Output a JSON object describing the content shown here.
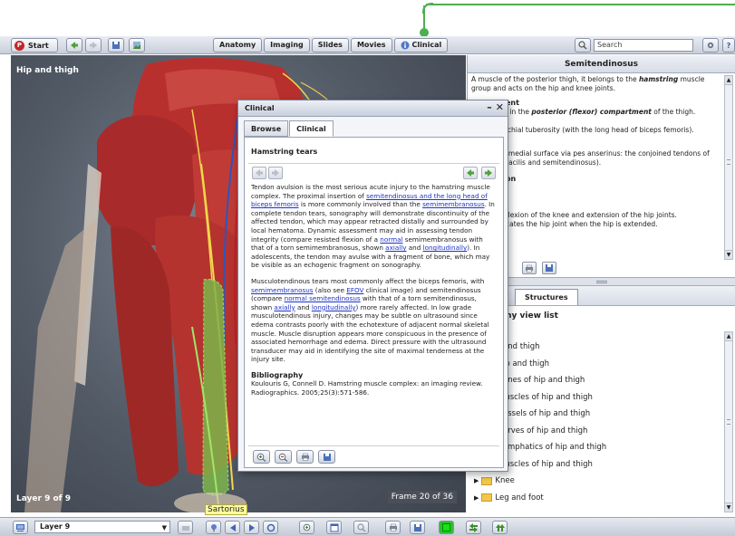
{
  "toolbar": {
    "start_label": "Start",
    "tabs": [
      "Anatomy",
      "Imaging",
      "Slides",
      "Movies",
      "Clinical"
    ],
    "search_placeholder": "Search"
  },
  "viewport": {
    "title": "Hip and thigh",
    "layer_status": "Layer 9 of 9",
    "frame_status": "Frame 20 of 36",
    "tooltip": "Sartorius"
  },
  "info_panel": {
    "title": "Semitendinosus",
    "intro_1": "A muscle of the posterior thigh, it belongs to the ",
    "intro_em": "hamstring",
    "intro_2": " muscle group and acts on the hip and knee joints.",
    "heading_1": "ent",
    "compartment_1": "l in the ",
    "compartment_em": "posterior (flexor) compartment",
    "compartment_2": " of the thigh.",
    "origin": "schial tuberosity (with the long head of biceps femoris).",
    "insertion_1": "(medial surface via pes anserinus: the conjoined tendons of",
    "insertion_2": "racilis and semitendinosus).",
    "heading_2": "on",
    "nerve_frag": ".",
    "action_1": "flexion of the knee and extension of the hip joints.",
    "action_2": "cates the hip joint when the hip is extended."
  },
  "structures": {
    "tab": "Structures",
    "heading": "omy view list",
    "items": [
      "and thigh",
      "ip and thigh",
      "ones of hip and thigh",
      "luscles of hip and thigh",
      "essels of hip and thigh",
      "erves of hip and thigh",
      "ymphatics of hip and thigh",
      "luscles of hip and thigh",
      "Knee",
      "Leg and foot"
    ]
  },
  "dialog": {
    "title": "Clinical",
    "tabs": [
      "Browse",
      "Clinical"
    ],
    "topic": "Hamstring tears",
    "p1": [
      {
        "t": "Tendon avulsion is the most serious acute injury to the hamstring muscle complex. The proximal insertion of "
      },
      {
        "t": "semitendinosus and the long head of biceps femoris",
        "link": true
      },
      {
        "t": " is more commonly involved than the "
      },
      {
        "t": "semimembranosus",
        "link": true
      },
      {
        "t": ". In complete tendon tears, sonography will demonstrate discontinuity of the affected tendon, which may appear retracted distally and surrounded by local hematoma. Dynamic assessment may aid in assessing tendon integrity (compare resisted flexion of a "
      },
      {
        "t": "normal",
        "link": true
      },
      {
        "t": " semimembranosus with that of a torn semimembranosus, shown "
      },
      {
        "t": "axially",
        "link": true
      },
      {
        "t": " and "
      },
      {
        "t": "longitudinally",
        "link": true
      },
      {
        "t": "). In adolescents, the tendon may avulse with a fragment of bone, which may be visible as an echogenic fragment on sonography."
      }
    ],
    "p2": [
      {
        "t": "Musculotendinous tears most commonly affect the biceps femoris, with "
      },
      {
        "t": "semimembranosus",
        "link": true
      },
      {
        "t": " (also see "
      },
      {
        "t": "EFOV",
        "link": true
      },
      {
        "t": " clinical image) and semitendinosus (compare "
      },
      {
        "t": "normal semitendinosus",
        "link": true
      },
      {
        "t": " with that of a torn semitendinosus, shown "
      },
      {
        "t": "axially",
        "link": true
      },
      {
        "t": " and "
      },
      {
        "t": "longitudinally",
        "link": true
      },
      {
        "t": ") more rarely affected. In low grade musculotendinous injury, changes may be subtle on ultrasound since edema contrasts poorly with the echotexture of adjacent normal skeletal muscle. Muscle disruption appears more conspicuous in the presence of associated hemorrhage and edema. Direct pressure with the ultrasound transducer may aid in identifying the site of maximal tenderness at the injury site."
      }
    ],
    "bib_heading": "Bibliography",
    "bib_text": "Koulouris G, Connell D. Hamstring muscle complex: an imaging review. Radiographics. 2005;25(3):571-586."
  },
  "bottombar": {
    "layer_value": "Layer 9"
  },
  "colors": {
    "callout": "#4caf50",
    "link": "#1b32c8",
    "tooltip_bg": "#ffff9c"
  }
}
